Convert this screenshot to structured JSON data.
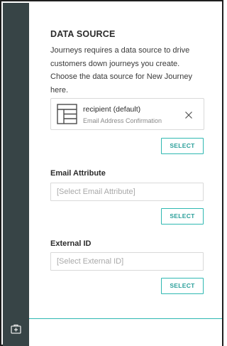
{
  "sidebar": {
    "icon": "add-panel-icon"
  },
  "panel": {
    "title": "DATA SOURCE",
    "description": "Journeys requires a data source to drive customers down journeys you create. Choose the data source for New Journey here."
  },
  "data_source": {
    "name": "recipient (default)",
    "subtitle": "Email Address Confirmation",
    "icon": "table-icon",
    "select_label": "SELECT"
  },
  "email_attribute": {
    "label": "Email Attribute",
    "placeholder": "[Select Email Attribute]",
    "value": "",
    "select_label": "SELECT"
  },
  "external_id": {
    "label": "External ID",
    "placeholder": "[Select External ID]",
    "value": "",
    "select_label": "SELECT"
  },
  "colors": {
    "rail": "#374446",
    "accent": "#2fb8b2",
    "accent_text": "#2a9f9a"
  }
}
